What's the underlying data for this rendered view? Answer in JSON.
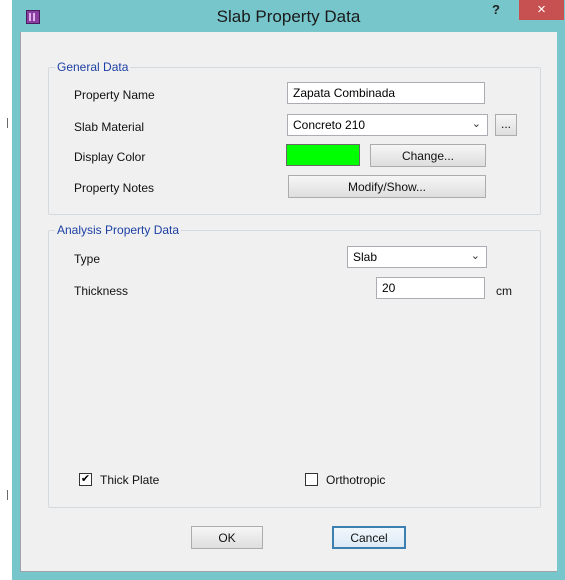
{
  "window": {
    "title": "Slab Property Data",
    "help_label": "?",
    "close_label": "×"
  },
  "general": {
    "group_title": "General Data",
    "property_name_label": "Property Name",
    "property_name_value": "Zapata Combinada",
    "slab_material_label": "Slab Material",
    "slab_material_value": "Concreto 210",
    "material_more_label": "...",
    "display_color_label": "Display Color",
    "display_color_value": "#00ff00",
    "change_label": "Change...",
    "property_notes_label": "Property Notes",
    "modify_show_label": "Modify/Show..."
  },
  "analysis": {
    "group_title": "Analysis Property Data",
    "type_label": "Type",
    "type_value": "Slab",
    "thickness_label": "Thickness",
    "thickness_value": "20",
    "thickness_unit": "cm",
    "thick_plate_label": "Thick Plate",
    "thick_plate_checked": true,
    "thick_plate_mark": "✔",
    "orthotropic_label": "Orthotropic",
    "orthotropic_checked": false
  },
  "footer": {
    "ok_label": "OK",
    "cancel_label": "Cancel"
  },
  "icons": {
    "app": "app-grid-icon",
    "chevron": "chevron-down-icon",
    "check": "checkmark-icon"
  }
}
